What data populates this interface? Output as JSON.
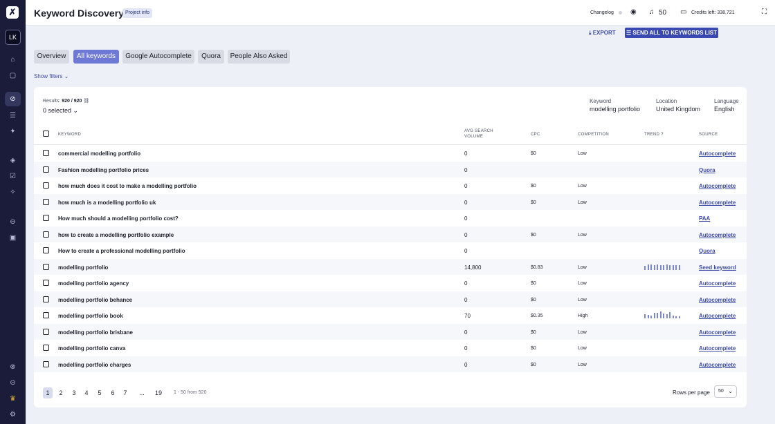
{
  "sidebar": {
    "logo": "✗",
    "avatar": "LK"
  },
  "header": {
    "title": "Keyword Discovery",
    "project_info": "Project info",
    "changelog": "Changelog",
    "notifications": "50",
    "credits": "Credits left: 338,721"
  },
  "actions": {
    "export": "EXPORT",
    "send_all": "SEND ALL TO KEYWORDS LIST"
  },
  "tabs": [
    {
      "label": "Overview"
    },
    {
      "label": "All keywords"
    },
    {
      "label": "Google Autocomplete"
    },
    {
      "label": "Quora"
    },
    {
      "label": "People Also Asked"
    }
  ],
  "filters": {
    "label": "Show filters"
  },
  "results": {
    "label": "Results:",
    "count": "920 / 920",
    "selected": "0 selected"
  },
  "meta": {
    "keyword_label": "Keyword",
    "keyword": "modelling portfolio",
    "location_label": "Location",
    "location": "United Kingdom",
    "language_label": "Language",
    "language": "English"
  },
  "columns": {
    "keyword": "KEYWORD",
    "volume_1": "AVG SEARCH",
    "volume_2": "VOLUME",
    "cpc": "CPC",
    "competition": "COMPETITION",
    "trend": "TREND",
    "source": "SOURCE"
  },
  "rows": [
    {
      "keyword": "commercial modelling portfolio",
      "volume": "0",
      "cpc": "$0",
      "competition": "Low",
      "source": "Autocomplete"
    },
    {
      "keyword": "Fashion modelling portfolio prices",
      "volume": "0",
      "cpc": "",
      "competition": "",
      "source": "Quora"
    },
    {
      "keyword": "how much does it cost to make a modelling portfolio",
      "volume": "0",
      "cpc": "$0",
      "competition": "Low",
      "source": "Autocomplete"
    },
    {
      "keyword": "how much is a modelling portfolio uk",
      "volume": "0",
      "cpc": "$0",
      "competition": "Low",
      "source": "Autocomplete"
    },
    {
      "keyword": "How much should a modelling portfolio cost?",
      "volume": "0",
      "cpc": "",
      "competition": "",
      "source": "PAA"
    },
    {
      "keyword": "how to create a modelling portfolio example",
      "volume": "0",
      "cpc": "$0",
      "competition": "Low",
      "source": "Autocomplete"
    },
    {
      "keyword": "How to create a professional modelling portfolio",
      "volume": "0",
      "cpc": "",
      "competition": "",
      "source": "Quora"
    },
    {
      "keyword": "modelling portfolio",
      "volume": "14,800",
      "cpc": "$0.83",
      "competition": "Low",
      "source": "Seed keyword",
      "trend": [
        0.6,
        0.8,
        0.8,
        0.7,
        0.8,
        0.7,
        0.7,
        0.8,
        0.7,
        0.7,
        0.7,
        0.7
      ]
    },
    {
      "keyword": "modelling portfolio agency",
      "volume": "0",
      "cpc": "$0",
      "competition": "Low",
      "source": "Autocomplete"
    },
    {
      "keyword": "modelling portfolio behance",
      "volume": "0",
      "cpc": "$0",
      "competition": "Low",
      "source": "Autocomplete"
    },
    {
      "keyword": "modelling portfolio book",
      "volume": "70",
      "cpc": "$0.35",
      "competition": "High",
      "source": "Autocomplete",
      "trend": [
        0.6,
        0.5,
        0.4,
        0.8,
        0.8,
        1.0,
        0.7,
        0.6,
        0.9,
        0.4,
        0.3,
        0.3
      ]
    },
    {
      "keyword": "modelling portfolio brisbane",
      "volume": "0",
      "cpc": "$0",
      "competition": "Low",
      "source": "Autocomplete"
    },
    {
      "keyword": "modelling portfolio canva",
      "volume": "0",
      "cpc": "$0",
      "competition": "Low",
      "source": "Autocomplete"
    },
    {
      "keyword": "modelling portfolio charges",
      "volume": "0",
      "cpc": "$0",
      "competition": "Low",
      "source": "Autocomplete"
    }
  ],
  "pagination": {
    "pages": [
      "1",
      "2",
      "3",
      "4",
      "5",
      "6",
      "7",
      "...",
      "19"
    ],
    "current": "1",
    "range": "1 - 50 from 920",
    "rows_per_page_label": "Rows per page",
    "rows_per_page": "50"
  }
}
